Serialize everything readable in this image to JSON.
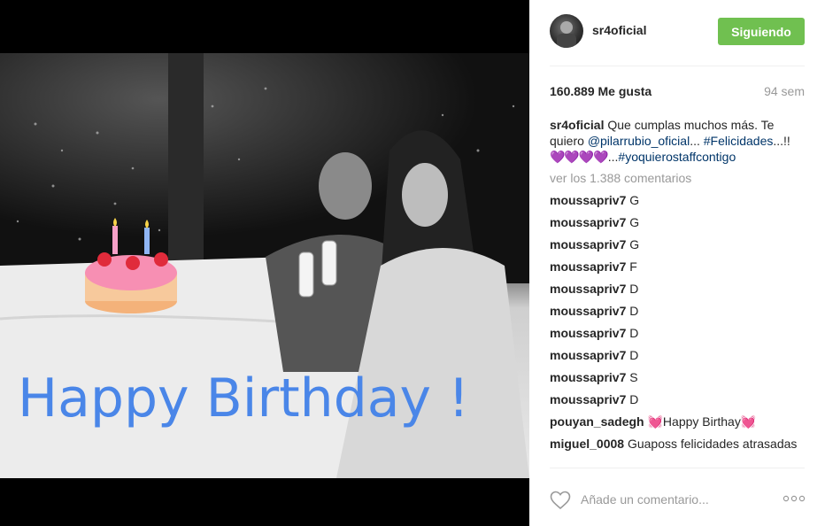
{
  "post": {
    "username": "sr4oficial",
    "follow_label": "Siguiendo",
    "likes": "160.889 Me gusta",
    "age": "94 sem",
    "caption": {
      "user": "sr4oficial",
      "text1": "Que cumplas muchos más. Te quiero",
      "mention": "@pilarrubio_oficial",
      "text2": "...",
      "hashtag1": "#Felicidades",
      "text3": "...!!",
      "hearts": "💜💜💜💜",
      "text4": "...",
      "hashtag2": "#yoquierostaffcontigo"
    },
    "view_comments": "ver los 1.388 comentarios",
    "comments": [
      {
        "user": "moussapriv7",
        "text": "G"
      },
      {
        "user": "moussapriv7",
        "text": "G"
      },
      {
        "user": "moussapriv7",
        "text": "G"
      },
      {
        "user": "moussapriv7",
        "text": "F"
      },
      {
        "user": "moussapriv7",
        "text": "D"
      },
      {
        "user": "moussapriv7",
        "text": "D"
      },
      {
        "user": "moussapriv7",
        "text": "D"
      },
      {
        "user": "moussapriv7",
        "text": "D"
      },
      {
        "user": "moussapriv7",
        "text": "S"
      },
      {
        "user": "moussapriv7",
        "text": "D"
      },
      {
        "user": "pouyan_sadegh",
        "text": "💓Happy Birthay💓"
      },
      {
        "user": "miguel_0008",
        "text": "Guaposs felicidades atrasadas"
      }
    ],
    "add_comment_placeholder": "Añade un comentario...",
    "image_overlay_text": "Happy Birthday !"
  },
  "icons": {
    "like": "heart-outline-icon",
    "options": "more-options-icon"
  },
  "colors": {
    "follow_button": "#70c050",
    "link": "#003569",
    "overlay_text": "#4a86e8"
  }
}
